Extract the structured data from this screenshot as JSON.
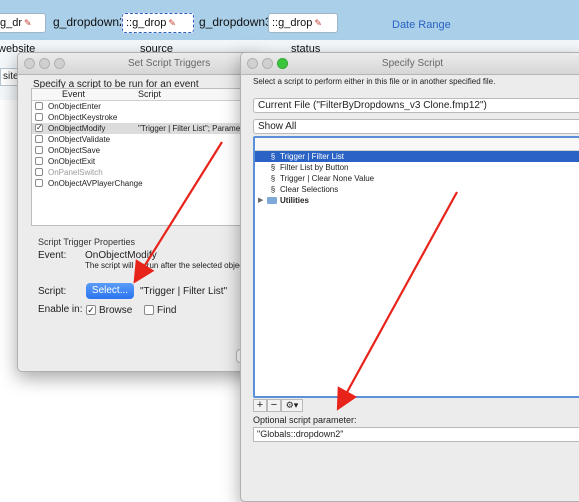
{
  "background": {
    "fields": [
      "g_dr",
      "::g_drop",
      "::g_drop"
    ],
    "labels": [
      "g_dropdown2",
      "g_dropdown3"
    ],
    "date_range": "Date Range",
    "columns": [
      "website",
      "source",
      "status"
    ],
    "partial_field": "site"
  },
  "triggers": {
    "title": "Set Script Triggers",
    "prompt": "Specify a script to be run for an event",
    "col_event": "Event",
    "col_script": "Script",
    "rows": [
      {
        "event": "OnObjectEnter",
        "checked": false,
        "script": ""
      },
      {
        "event": "OnObjectKeystroke",
        "checked": false,
        "script": ""
      },
      {
        "event": "OnObjectModify",
        "checked": true,
        "script": "\"Trigger | Filter List\"; Parameter"
      },
      {
        "event": "OnObjectValidate",
        "checked": false,
        "script": ""
      },
      {
        "event": "OnObjectSave",
        "checked": false,
        "script": ""
      },
      {
        "event": "OnObjectExit",
        "checked": false,
        "script": ""
      },
      {
        "event": "OnPanelSwitch",
        "checked": false,
        "script": ""
      },
      {
        "event": "OnObjectAVPlayerChange",
        "checked": false,
        "script": ""
      }
    ],
    "props_title": "Script Trigger Properties",
    "event_label": "Event:",
    "event_value": "OnObjectModify",
    "event_desc": "The script will be run after the selected object is",
    "script_label": "Script:",
    "select_button": "Select...",
    "script_value": "\"Trigger | Filter List\"",
    "enable_label": "Enable in:",
    "browse_label": "Browse",
    "find_label": "Find",
    "browse_checked": true,
    "find_checked": false
  },
  "specify": {
    "title": "Specify Script",
    "prompt": "Select a script to perform either in this file or in another specified file.",
    "file_popup": "Current File (\"FilterByDropdowns_v3 Clone.fmp12\")",
    "show_popup": "Show All",
    "scripts": [
      {
        "label": "Trigger | Filter List",
        "selected": true
      },
      {
        "label": "Filter List by Button",
        "selected": false
      },
      {
        "label": "Trigger | Clear None Value",
        "selected": false
      },
      {
        "label": "Clear Selections",
        "selected": false
      }
    ],
    "folder": "Utilities",
    "add_btn": "+",
    "remove_btn": "−",
    "gear_btn": "⚙▾",
    "param_label": "Optional script parameter:",
    "param_value": "\"Globals::dropdown2\""
  },
  "colors": {
    "accent": "#2a63c4",
    "arrow": "#e8231a",
    "header_blue": "#a9cfe9"
  }
}
